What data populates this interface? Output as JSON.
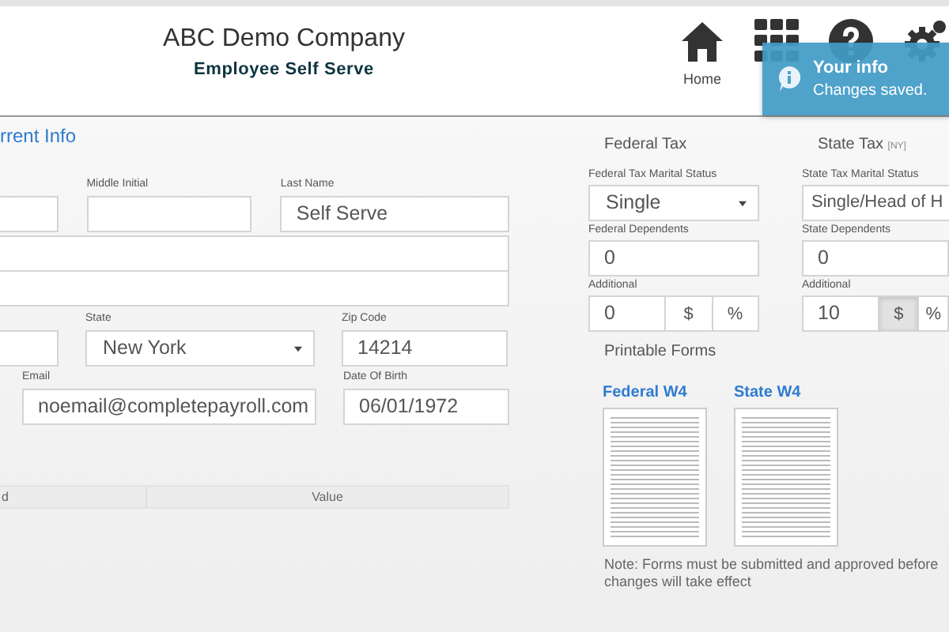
{
  "header": {
    "company": "ABC Demo Company",
    "subtitle": "Employee Self Serve",
    "nav": [
      {
        "kind": "home",
        "label": "Home"
      },
      {
        "kind": "grid"
      },
      {
        "kind": "help"
      },
      {
        "kind": "settings"
      }
    ]
  },
  "toast": {
    "title": "Your info",
    "message": "Changes saved."
  },
  "current_info": {
    "title": "rrent Info",
    "rows": [
      [
        {
          "kind": "text"
        },
        {
          "kind": "text",
          "label": "Middle Initial"
        },
        {
          "kind": "text",
          "label": "Last Name",
          "value": "Self Serve"
        }
      ],
      [
        {
          "kind": "text"
        }
      ],
      [
        {
          "kind": "text"
        }
      ],
      [
        {
          "kind": "text"
        },
        {
          "kind": "select",
          "label": "State",
          "value": "New York"
        },
        {
          "kind": "text",
          "label": "Zip Code",
          "value": "14214"
        }
      ],
      [
        {
          "kind": "text",
          "label": "Email",
          "value": "noemail@completepayroll.com"
        },
        {
          "kind": "text",
          "label": "Date Of Birth",
          "value": "06/01/1972"
        }
      ]
    ],
    "table": {
      "columns": [
        "d",
        "Value"
      ]
    }
  },
  "taxes": [
    {
      "title": "Federal Tax",
      "marital_label": "Federal Tax Marital Status",
      "marital_value": "Single",
      "dependents_label": "Federal Dependents",
      "dependents_value": "0",
      "additional_label": "Additional",
      "additional_value": "0",
      "units": [
        {
          "label": "$",
          "selected": false
        },
        {
          "label": "%",
          "selected": false
        }
      ]
    },
    {
      "title": "State Tax",
      "tag": "[NY]",
      "marital_label": "State Tax Marital Status",
      "marital_value": "Single/Head of H",
      "dependents_label": "State Dependents",
      "dependents_value": "0",
      "additional_label": "Additional",
      "additional_value": "10",
      "units": [
        {
          "label": "$",
          "selected": true
        },
        {
          "label": "%",
          "selected": false
        }
      ]
    }
  ],
  "forms": {
    "title": "Printable Forms",
    "links": [
      {
        "label": "Federal W4"
      },
      {
        "label": "State W4"
      }
    ],
    "note": "Note: Forms must be submitted and approved before changes will take effect"
  }
}
